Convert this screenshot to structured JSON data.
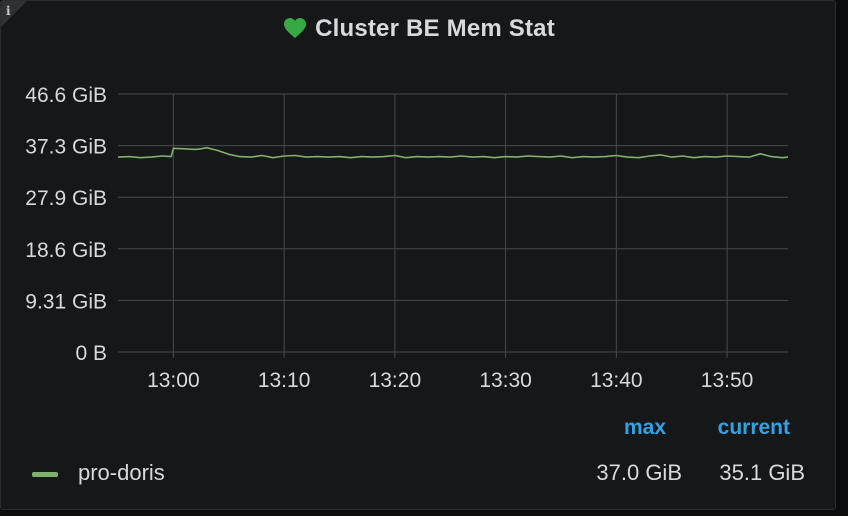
{
  "panel": {
    "title": "Cluster BE Mem Stat",
    "info_icon": "info-icon",
    "status_icon": "heart-icon",
    "status_color": "#37a844"
  },
  "chart_data": {
    "type": "line",
    "title": "Cluster BE Mem Stat",
    "xlabel": "",
    "ylabel": "",
    "y_unit": "GiB",
    "ylim": [
      0,
      46.6
    ],
    "ytick_labels": [
      "0 B",
      "9.31 GiB",
      "18.6 GiB",
      "27.9 GiB",
      "37.3 GiB",
      "46.6 GiB"
    ],
    "xtick_labels": [
      "13:00",
      "13:10",
      "13:20",
      "13:30",
      "13:40",
      "13:50"
    ],
    "x_unit": "minutes after 12:55",
    "xlim": [
      0,
      60.5
    ],
    "grid": true,
    "legend_position": "bottom-left",
    "series": [
      {
        "name": "pro-doris",
        "color": "#7eb26d",
        "x": [
          0,
          1,
          2,
          3,
          4,
          4.8,
          5,
          6,
          7,
          7.5,
          8,
          9,
          10,
          11,
          12,
          13,
          14,
          15,
          16,
          17,
          18,
          19,
          20,
          21,
          22,
          23,
          24,
          25,
          26,
          27,
          28,
          29,
          30,
          31,
          32,
          33,
          34,
          35,
          36,
          37,
          38,
          39,
          40,
          41,
          42,
          43,
          44,
          45,
          46,
          47,
          48,
          49,
          50,
          51,
          52,
          53,
          54,
          55,
          56,
          57,
          58,
          59,
          60,
          60.5
        ],
        "values": [
          35.2,
          35.3,
          35.1,
          35.2,
          35.4,
          35.3,
          36.8,
          36.7,
          36.6,
          36.7,
          36.9,
          36.4,
          35.7,
          35.3,
          35.2,
          35.5,
          35.1,
          35.4,
          35.5,
          35.2,
          35.3,
          35.2,
          35.3,
          35.1,
          35.3,
          35.2,
          35.3,
          35.5,
          35.1,
          35.3,
          35.2,
          35.3,
          35.2,
          35.4,
          35.2,
          35.3,
          35.1,
          35.3,
          35.2,
          35.4,
          35.3,
          35.2,
          35.4,
          35.1,
          35.3,
          35.2,
          35.3,
          35.5,
          35.2,
          35.1,
          35.4,
          35.6,
          35.2,
          35.4,
          35.1,
          35.3,
          35.2,
          35.4,
          35.3,
          35.2,
          35.8,
          35.3,
          35.1,
          35.2
        ]
      }
    ]
  },
  "legend": {
    "headers": {
      "max": "max",
      "current": "current"
    },
    "items": [
      {
        "name": "pro-doris",
        "max": "37.0 GiB",
        "current": "35.1 GiB",
        "color": "#7eb26d"
      }
    ]
  }
}
